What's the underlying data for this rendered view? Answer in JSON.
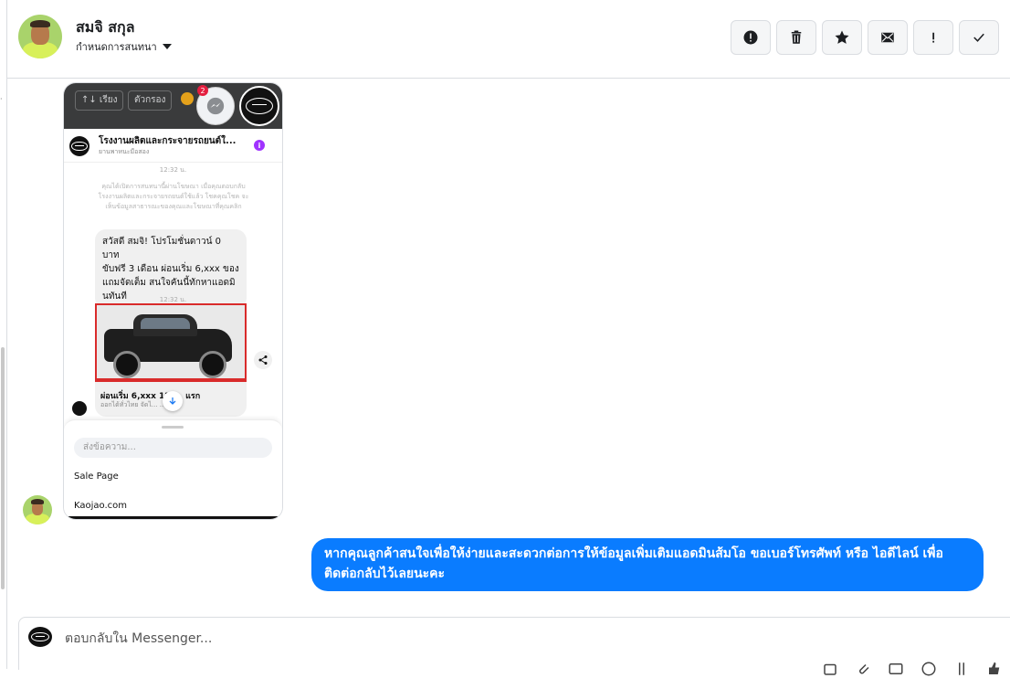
{
  "header": {
    "user_name": "สมจิ สกุล",
    "assign_label": "กำหนดการสนทนา",
    "toolbar": [
      {
        "name": "spam-alert-button",
        "icon": "alert-circle-icon"
      },
      {
        "name": "delete-button",
        "icon": "trash-icon"
      },
      {
        "name": "star-button",
        "icon": "star-icon"
      },
      {
        "name": "mark-unread-button",
        "icon": "mail-icon"
      },
      {
        "name": "priority-button",
        "icon": "exclamation-icon"
      },
      {
        "name": "done-button",
        "icon": "check-icon"
      }
    ]
  },
  "shared_screenshot": {
    "sort_label": "↑↓ เรียง",
    "filter_label": "ตัวกรอง",
    "badge_count": "2",
    "page_name": "โรงงานผลิตและกระจายรถยนต์ใ...",
    "page_sub": "ยานพาหนะมือสอง",
    "time1": "12:32 น.",
    "note": "คุณได้เปิดการสนทนานี้ผ่านโฆษณา เมื่อคุณตอบกลับ โรงงานผลิตและกระจายรถยนต์ใช้แล้ว โชคคุณโชค จะเห็นข้อมูลสาธารณะของคุณและโฆษณาที่คุณคลิก",
    "bubble_lines": [
      "สวัสดี สมจิ! โปรโมชั่นดาวน์ 0 บาท",
      "ขับฟรี 3 เดือน ผ่อนเริ่ม 6,xxx ของ",
      "แถมจัดเต็ม สนใจคันนี้ทักหาแอดมิ",
      "นทันที"
    ],
    "time2": "12:32 น.",
    "card_title": "ผ่อนเริ่ม 6,xxx 12 ... แรก",
    "card_sub": "ออกได้ทั่วไทย จัดไ... ...ฟ",
    "input_placeholder": "ส่งข้อความ...",
    "option1": "Sale Page",
    "option2": "Kaojao.com"
  },
  "sent_message": "หากคุณลูกค้าสนใจเพื่อให้ง่ายและสะดวกต่อการให้ข้อมูลเพิ่มเติมแอดมินส้มโอ ขอเบอร์โทรศัพท์ หรือ ไอดีไลน์ เพื่อติดต่อกลับไว้เลยนะคะ",
  "composer": {
    "placeholder": "ตอบกลับใน Messenger...",
    "tools": [
      "upload-icon",
      "attach-icon",
      "gif-icon",
      "emoji-icon",
      "hashtag-icon",
      "like-icon"
    ]
  },
  "colors": {
    "accent": "#0a7cff",
    "border": "#dadde1",
    "purple": "#a033ff"
  }
}
